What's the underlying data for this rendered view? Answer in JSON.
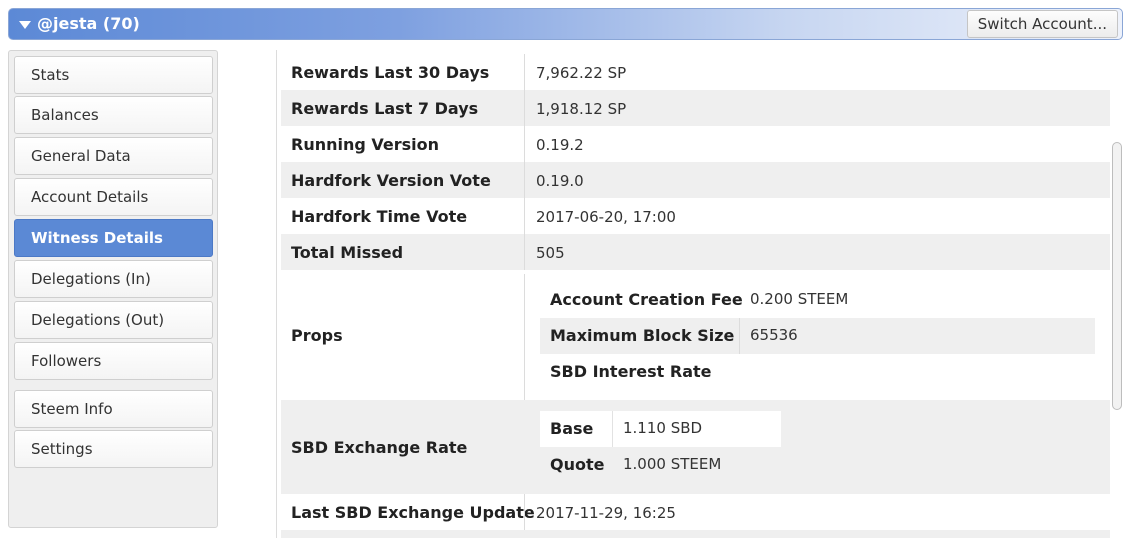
{
  "header": {
    "account_label": "@jesta (70)",
    "switch_label": "Switch Account..."
  },
  "sidebar": {
    "items": [
      {
        "label": "Stats"
      },
      {
        "label": "Balances"
      },
      {
        "label": "General Data"
      },
      {
        "label": "Account Details"
      },
      {
        "label": "Witness Details",
        "active": true
      },
      {
        "label": "Delegations (In)"
      },
      {
        "label": "Delegations (Out)"
      },
      {
        "label": "Followers"
      },
      {
        "label": "Steem Info"
      },
      {
        "label": "Settings"
      }
    ]
  },
  "details": {
    "rows": [
      {
        "label": "Rewards Last 30 Days",
        "value": "7,962.22 SP"
      },
      {
        "label": "Rewards Last 7 Days",
        "value": "1,918.12 SP"
      },
      {
        "label": "Running Version",
        "value": "0.19.2"
      },
      {
        "label": "Hardfork Version Vote",
        "value": "0.19.0"
      },
      {
        "label": "Hardfork Time Vote",
        "value": "2017-06-20, 17:00"
      },
      {
        "label": "Total Missed",
        "value": "505"
      }
    ],
    "props": {
      "label": "Props",
      "items": [
        {
          "key": "Account Creation Fee",
          "value": "0.200 STEEM"
        },
        {
          "key": "Maximum Block Size",
          "value": "65536"
        },
        {
          "key": "SBD Interest Rate",
          "value": ""
        }
      ]
    },
    "sbd_exchange": {
      "label": "SBD Exchange Rate",
      "items": [
        {
          "key": "Base",
          "value": "1.110 SBD"
        },
        {
          "key": "Quote",
          "value": "1.000 STEEM"
        }
      ]
    },
    "last_update": {
      "label": "Last SBD Exchange Update",
      "value": "2017-11-29, 16:25"
    }
  }
}
